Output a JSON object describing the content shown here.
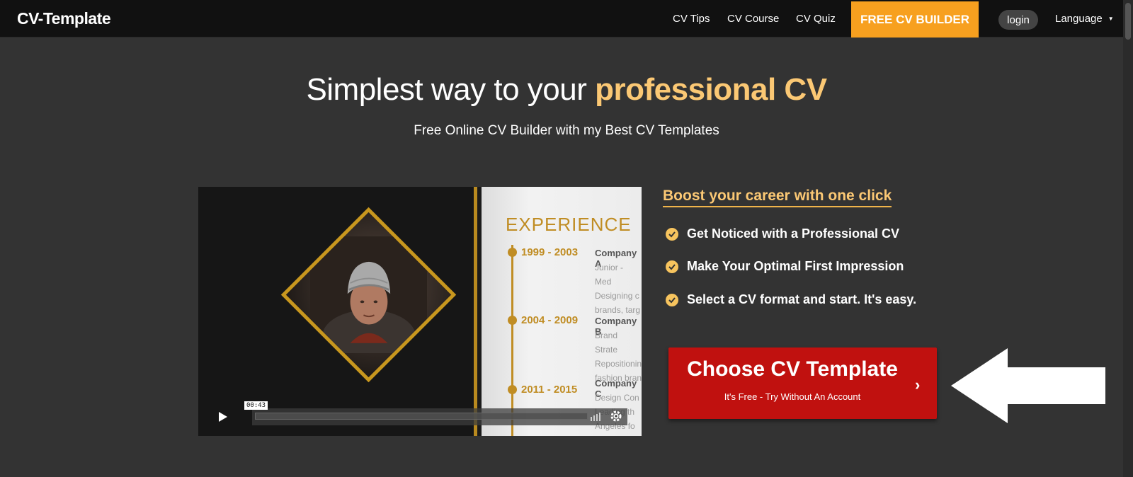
{
  "navbar": {
    "logo": "CV-Template",
    "links": [
      "CV Tips",
      "CV Course",
      "CV Quiz"
    ],
    "cta_label": "FREE CV BUILDER",
    "login_label": "login",
    "language_label": "Language",
    "cta_color": "#f7a01f"
  },
  "hero": {
    "title_main": "Simplest way to your ",
    "title_accent": "professional CV",
    "subtitle": "Free Online CV Builder with my Best CV Templates",
    "accent_color": "#fbc874"
  },
  "video": {
    "time": "00:43",
    "cv_heading": "EXPERIENCE",
    "entries": [
      {
        "years": "1999 - 2003",
        "company": "Company A",
        "text": [
          "Junior - Med",
          "Designing c",
          "brands, targ"
        ]
      },
      {
        "years": "2004 - 2009",
        "company": "Company B",
        "text": [
          "Brand Strate",
          "Repositionin",
          "fashion bran"
        ]
      },
      {
        "years": "2011 - 2015",
        "company": "Company C",
        "text": [
          "Design Con",
          "Leading th",
          "Angeles fo"
        ]
      }
    ]
  },
  "panel": {
    "boost_title": "Boost your career with one click",
    "features": [
      "Get Noticed with a Professional CV",
      "Make Your Optimal First Impression",
      "Select a CV format and start. It's easy."
    ],
    "cta_title": "Choose CV Template",
    "cta_sub": "It's Free - Try Without An Account",
    "cta_chevron": "›",
    "cta_color": "#c0110f"
  }
}
